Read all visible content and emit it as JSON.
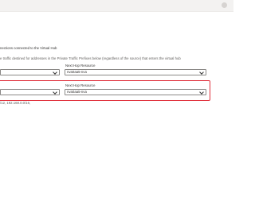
{
  "routing": {
    "connections_text": "nections connected to the Virtual Hub",
    "private_traffic_desc": "e traffic destined for addresses in the Private Traffic Prefixes below (regardless of the source) that enters the virtual hub",
    "row1": {
      "left_select_value": "",
      "next_hop_label": "Next Hop Resource",
      "next_hop_value": "nva0aa5-nva"
    },
    "row2": {
      "left_select_value": "",
      "next_hop_label": "Next Hop Resource",
      "next_hop_value": "nva0aa5-nva"
    },
    "prefixes_text": "/12, 192.168.0.0/16,"
  }
}
